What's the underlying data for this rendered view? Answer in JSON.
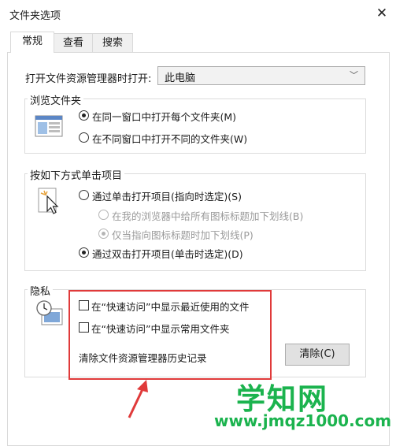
{
  "window": {
    "title": "文件夹选项"
  },
  "tabs": [
    {
      "label": "常规"
    },
    {
      "label": "查看"
    },
    {
      "label": "搜索"
    }
  ],
  "open_explorer": {
    "label": "打开文件资源管理器时打开:",
    "value": "此电脑"
  },
  "browse_folders": {
    "legend": "浏览文件夹",
    "options": [
      {
        "label": "在同一窗口中打开每个文件夹(M)",
        "checked": true
      },
      {
        "label": "在不同窗口中打开不同的文件夹(W)",
        "checked": false
      }
    ]
  },
  "click_items": {
    "legend": "按如下方式单击项目",
    "options": [
      {
        "label": "通过单击打开项目(指向时选定)(S)",
        "checked": false
      },
      {
        "label": "在我的浏览器中给所有图标标题加下划线(B)",
        "checked": false,
        "disabled": true
      },
      {
        "label": "仅当指向图标标题时加下划线(P)",
        "checked": true,
        "disabled": true
      },
      {
        "label": "通过双击打开项目(单击时选定)(D)",
        "checked": true
      }
    ]
  },
  "privacy": {
    "legend": "隐私",
    "checkboxes": [
      {
        "label": "在“快速访问”中显示最近使用的文件",
        "checked": false
      },
      {
        "label": "在“快速访问”中显示常用文件夹",
        "checked": false
      }
    ],
    "clear_label": "清除文件资源管理器历史记录",
    "clear_button": "清除(C)"
  },
  "watermark": {
    "text": "学知网",
    "url": "www.jmqz1000.com"
  },
  "colors": {
    "highlight_box": "#e03a3a",
    "watermark": "#1bb34e"
  }
}
